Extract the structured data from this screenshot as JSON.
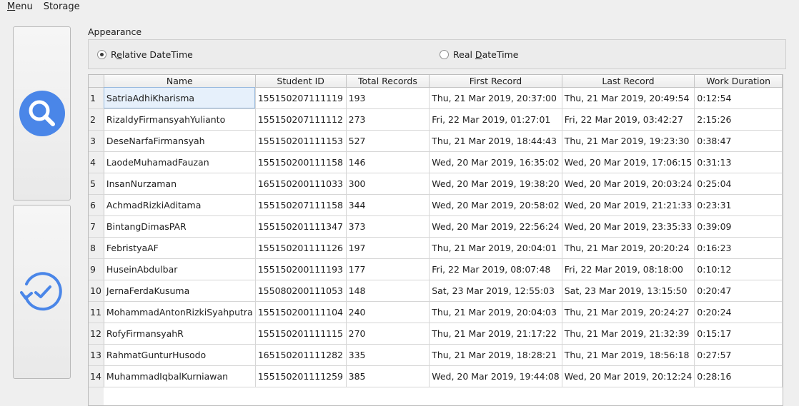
{
  "menubar": {
    "items": [
      {
        "first": "M",
        "rest": "enu"
      },
      {
        "first": "",
        "rest": "Storage"
      }
    ]
  },
  "appearance": {
    "label": "Appearance",
    "options": [
      {
        "pre": "R",
        "ul": "e",
        "post": "lative DateTime",
        "checked": true
      },
      {
        "pre": "Real ",
        "ul": "D",
        "post": "ateTime",
        "checked": false
      }
    ]
  },
  "table": {
    "columns": [
      "Name",
      "Student ID",
      "Total Records",
      "First Record",
      "Last Record",
      "Work Duration"
    ],
    "rows": [
      [
        "SatriaAdhiKharisma",
        "155150207111119",
        "193",
        "Thu, 21 Mar 2019, 20:37:00",
        "Thu, 21 Mar 2019, 20:49:54",
        "0:12:54"
      ],
      [
        "RizaldyFirmansyahYulianto",
        "155150207111112",
        "273",
        "Fri, 22 Mar 2019, 01:27:01",
        "Fri, 22 Mar 2019, 03:42:27",
        "2:15:26"
      ],
      [
        "DeseNarfaFirmansyah",
        "155150201111153",
        "527",
        "Thu, 21 Mar 2019, 18:44:43",
        "Thu, 21 Mar 2019, 19:23:30",
        "0:38:47"
      ],
      [
        "LaodeMuhamadFauzan",
        "155150200111158",
        "146",
        "Wed, 20 Mar 2019, 16:35:02",
        "Wed, 20 Mar 2019, 17:06:15",
        "0:31:13"
      ],
      [
        "InsanNurzaman",
        "165150200111033",
        "300",
        "Wed, 20 Mar 2019, 19:38:20",
        "Wed, 20 Mar 2019, 20:03:24",
        "0:25:04"
      ],
      [
        "AchmadRizkiAditama",
        "155150207111158",
        "344",
        "Wed, 20 Mar 2019, 20:58:02",
        "Wed, 20 Mar 2019, 21:21:33",
        "0:23:31"
      ],
      [
        "BintangDimasPAR",
        "155150201111347",
        "373",
        "Wed, 20 Mar 2019, 22:56:24",
        "Wed, 20 Mar 2019, 23:35:33",
        "0:39:09"
      ],
      [
        "FebristyaAF",
        "155150201111126",
        "197",
        "Thu, 21 Mar 2019, 20:04:01",
        "Thu, 21 Mar 2019, 20:20:24",
        "0:16:23"
      ],
      [
        "HuseinAbdulbar",
        "155150200111193",
        "177",
        "Fri, 22 Mar 2019, 08:07:48",
        "Fri, 22 Mar 2019, 08:18:00",
        "0:10:12"
      ],
      [
        "JernaFerdaKusuma",
        "155080200111053",
        "148",
        "Sat, 23 Mar 2019, 12:55:03",
        "Sat, 23 Mar 2019, 13:15:50",
        "0:20:47"
      ],
      [
        "MohammadAntonRizkiSyahputra",
        "155150200111104",
        "240",
        "Thu, 21 Mar 2019, 20:04:03",
        "Thu, 21 Mar 2019, 20:24:27",
        "0:20:24"
      ],
      [
        "RofyFirmansyahR",
        "155150201111115",
        "270",
        "Thu, 21 Mar 2019, 21:17:22",
        "Thu, 21 Mar 2019, 21:32:39",
        "0:15:17"
      ],
      [
        "RahmatGunturHusodo",
        "165150201111282",
        "335",
        "Thu, 21 Mar 2019, 18:28:21",
        "Thu, 21 Mar 2019, 18:56:18",
        "0:27:57"
      ],
      [
        "MuhammadIqbalKurniawan",
        "155150201111259",
        "385",
        "Wed, 20 Mar 2019, 19:44:08",
        "Wed, 20 Mar 2019, 20:12:24",
        "0:28:16"
      ]
    ],
    "selected_row": 0
  },
  "icons": {
    "search": "search-icon",
    "history": "history-icon",
    "accent": "#4a86e8"
  }
}
